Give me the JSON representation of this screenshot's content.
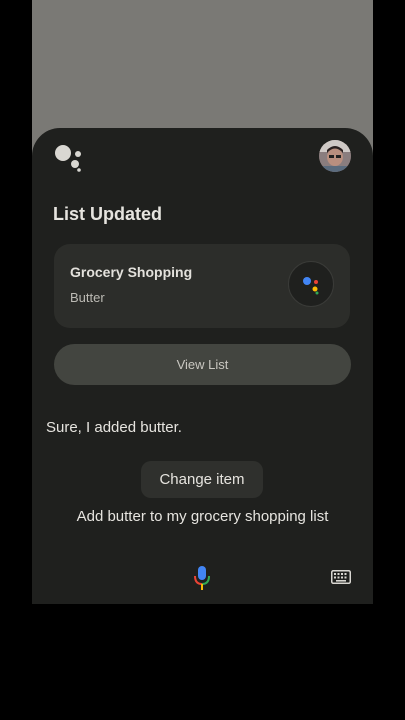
{
  "assistant": {
    "title": "List Updated",
    "card": {
      "title": "Grocery Shopping",
      "subtitle": "Butter"
    },
    "view_list_label": "View List",
    "reply": "Sure, I added butter.",
    "suggestion_chip": "Change item",
    "user_query": "Add butter to my grocery shopping list"
  },
  "colors": {
    "google_blue": "#4285F4",
    "google_red": "#EA4335",
    "google_yellow": "#FBBC05",
    "google_green": "#34A853",
    "sheet_background": "#1f201e"
  },
  "icons": [
    "assistant-logo-icon",
    "avatar",
    "assistant-dots-icon",
    "mic-icon",
    "keyboard-icon"
  ]
}
